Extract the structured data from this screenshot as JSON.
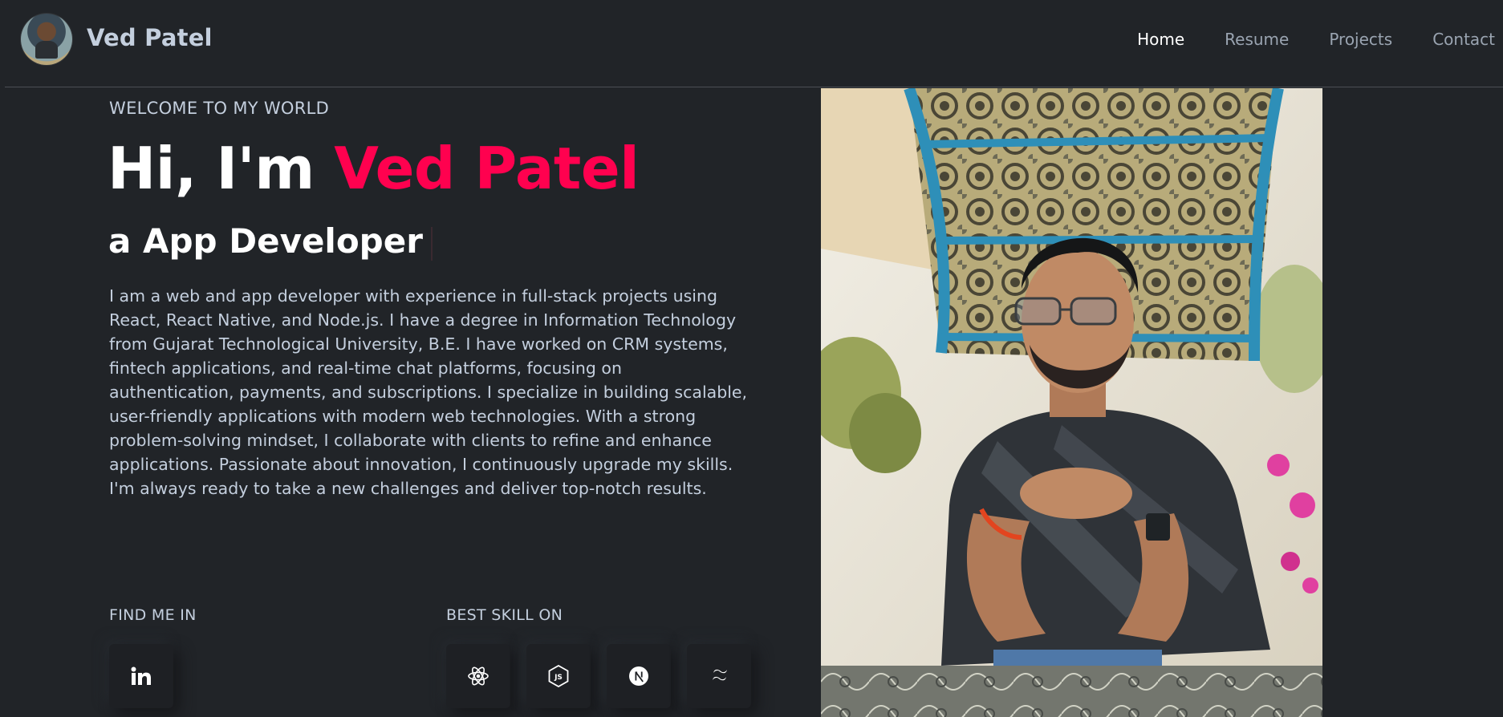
{
  "header": {
    "brand_name": "Ved Patel",
    "nav": [
      {
        "label": "Home",
        "active": true
      },
      {
        "label": "Resume",
        "active": false
      },
      {
        "label": "Projects",
        "active": false
      },
      {
        "label": "Contact",
        "active": false
      }
    ]
  },
  "hero": {
    "welcome": "WELCOME TO MY WORLD",
    "greeting": "Hi, I'm ",
    "name": "Ved Patel",
    "role": "a App Developer",
    "bio": "I am a web and app developer with experience in full-stack projects using React, React Native, and Node.js. I have a degree in Information Technology from Gujarat Technological University, B.E. I have worked on CRM systems, fintech applications, and real-time chat platforms, focusing on authentication, payments, and subscriptions. I specialize in building scalable, user-friendly applications with modern web technologies. With a strong problem-solving mindset, I collaborate with clients to refine and enhance applications. Passionate about innovation, I continuously upgrade my skills. I'm always ready to take a new challenges and deliver top-notch results."
  },
  "find_me": {
    "label": "FIND ME IN",
    "icons": [
      "linkedin-icon"
    ]
  },
  "skills": {
    "label": "BEST SKILL ON",
    "icons": [
      "react-icon",
      "nodejs-icon",
      "nextjs-icon",
      "tailwind-icon"
    ]
  },
  "colors": {
    "background": "#212428",
    "accent": "#ff014f",
    "text": "#c4cfde",
    "heading": "#ffffff"
  }
}
